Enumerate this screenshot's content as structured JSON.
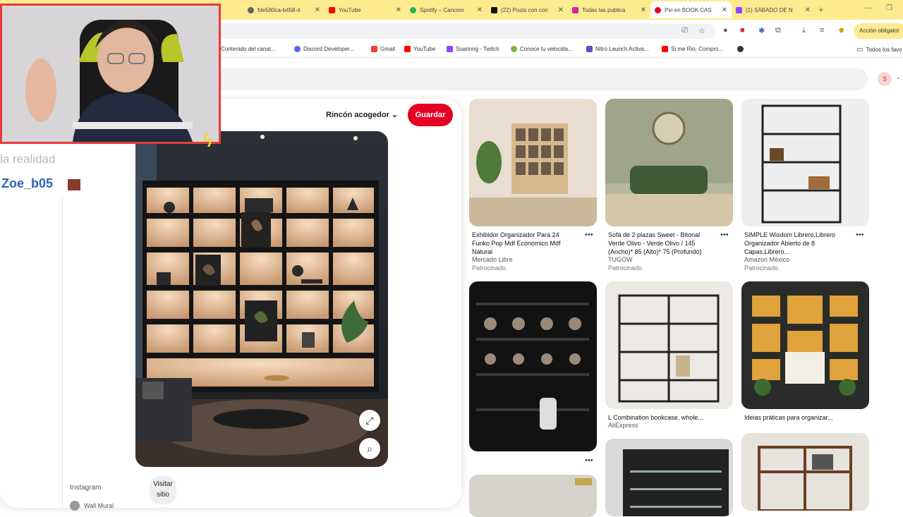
{
  "browser": {
    "tabs": [
      {
        "label": "fde580ca-b458-4"
      },
      {
        "label": "YouTube"
      },
      {
        "label": "Spotify – Cancion"
      },
      {
        "label": "(22) Posts con con"
      },
      {
        "label": "Todas las publica"
      },
      {
        "label": "Pin en BOOK CAS"
      },
      {
        "label": "(1) SÁBADO DE N"
      }
    ],
    "action_badge": "Acción obligator",
    "bookmarks": [
      {
        "label": "Contenido del canal..."
      },
      {
        "label": "Discord Developer..."
      },
      {
        "label": "Gmail"
      },
      {
        "label": "YouTube"
      },
      {
        "label": "Soarinng - Twitch"
      },
      {
        "label": "Conoce tu velocida..."
      },
      {
        "label": "Nitro Launch Activa..."
      },
      {
        "label": "Si me Rio, Compro..."
      }
    ],
    "all_bookmarks": "Todos los favo"
  },
  "header": {
    "avatar_initial": "S"
  },
  "pin": {
    "board_name": "Rincón acogedor",
    "save_label": "Guardar",
    "source": "Instagram",
    "visit_label": "Visitar sitio",
    "author": "Wall Mural"
  },
  "overlay": {
    "chat_text": "la realidad",
    "username": "Zoe_b05"
  },
  "feed": [
    {
      "title": "Exhibidor Organizador Para 24 Funko Pop Mdf Economico Mdf Natural",
      "source": "Mercado Libre",
      "sponsored": "Patrocinado"
    },
    {
      "title": "Sofá de 2 plazas Sweet - Bitonal Verde Olivo - Verde Olivo / 145 (Ancho)* 85 (Alto)* 75 (Profundo)",
      "source": "TUGOW",
      "sponsored": "Patrocinado"
    },
    {
      "title": "SIMPLE Wisdom Librero,Librero Organizador Abierto de 8 Capas,Librero...",
      "source": "Amazon México",
      "sponsored": "Patrocinado"
    },
    {
      "title": "",
      "source": "",
      "sponsored": ""
    },
    {
      "title": "L Combination bookcase, whole...",
      "source": "AliExpress",
      "sponsored": ""
    },
    {
      "title": "Ideias práticas para organizar...",
      "source": "",
      "sponsored": ""
    }
  ],
  "colors": {
    "accent": "#e60023",
    "tabbar": "#fdeb8f",
    "cam_border": "#e63b3b"
  }
}
